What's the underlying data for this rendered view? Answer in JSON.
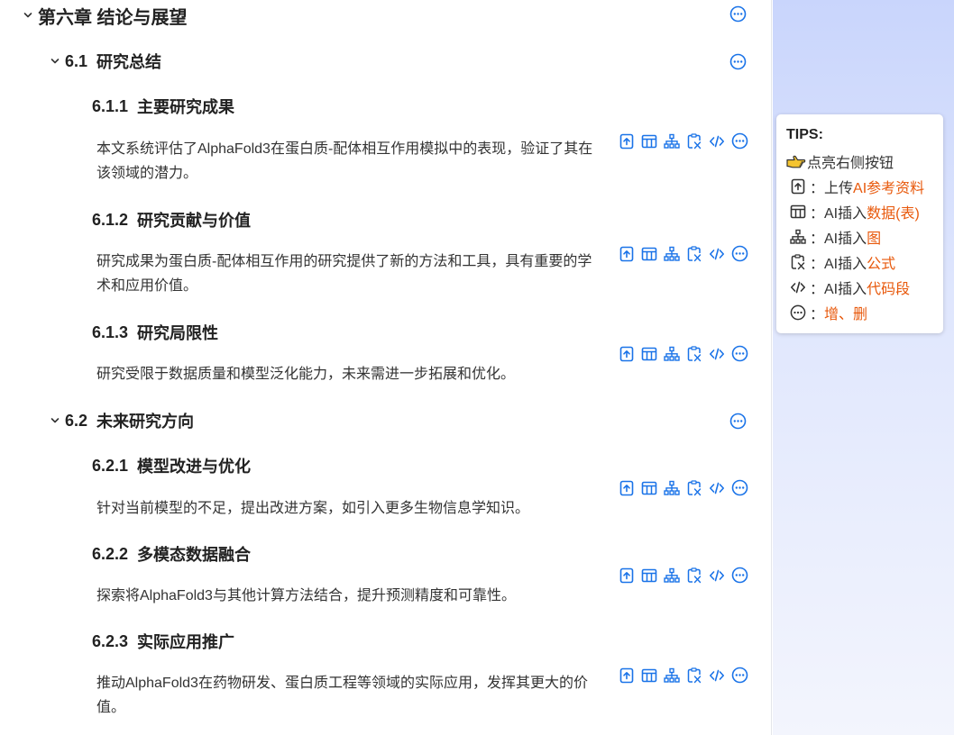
{
  "outline": {
    "chapter": {
      "label": "第六章  结论与展望"
    },
    "sections": [
      {
        "number": "6.1",
        "title": "研究总结",
        "subsections": [
          {
            "number": "6.1.1",
            "title": "主要研究成果",
            "text": "本文系统评估了AlphaFold3在蛋白质-配体相互作用模拟中的表现，验证了其在该领域的潜力。"
          },
          {
            "number": "6.1.2",
            "title": "研究贡献与价值",
            "text": "研究成果为蛋白质-配体相互作用的研究提供了新的方法和工具，具有重要的学术和应用价值。"
          },
          {
            "number": "6.1.3",
            "title": "研究局限性",
            "text": "研究受限于数据质量和模型泛化能力，未来需进一步拓展和优化。"
          }
        ]
      },
      {
        "number": "6.2",
        "title": "未来研究方向",
        "subsections": [
          {
            "number": "6.2.1",
            "title": "模型改进与优化",
            "text": "针对当前模型的不足，提出改进方案，如引入更多生物信息学知识。"
          },
          {
            "number": "6.2.2",
            "title": "多模态数据融合",
            "text": "探索将AlphaFold3与其他计算方法结合，提升预测精度和可靠性。"
          },
          {
            "number": "6.2.3",
            "title": "实际应用推广",
            "text": "推动AlphaFold3在药物研发、蛋白质工程等领域的实际应用，发挥其更大的价值。"
          }
        ]
      }
    ]
  },
  "icons": {
    "upload": "upload-icon",
    "table": "table-icon",
    "diagram": "diagram-icon",
    "formula": "formula-icon",
    "code": "code-icon",
    "more": "more-icon"
  },
  "tips": {
    "title": "TIPS:",
    "intro": "点亮右侧按钮",
    "items": [
      {
        "prefix": "：上传",
        "highlight": "AI参考资料"
      },
      {
        "prefix": "：AI插入",
        "highlight": "数据(表)"
      },
      {
        "prefix": "：AI插入",
        "highlight": "图"
      },
      {
        "prefix": "：AI插入",
        "highlight": "公式"
      },
      {
        "prefix": "：AI插入",
        "highlight": "代码段"
      },
      {
        "prefix": "：",
        "highlight": "增、删"
      }
    ]
  },
  "colors": {
    "accent_icon": "#1a73e8",
    "highlight": "#e8590c",
    "sidebar_gradient_top": "#c9d5fc"
  }
}
